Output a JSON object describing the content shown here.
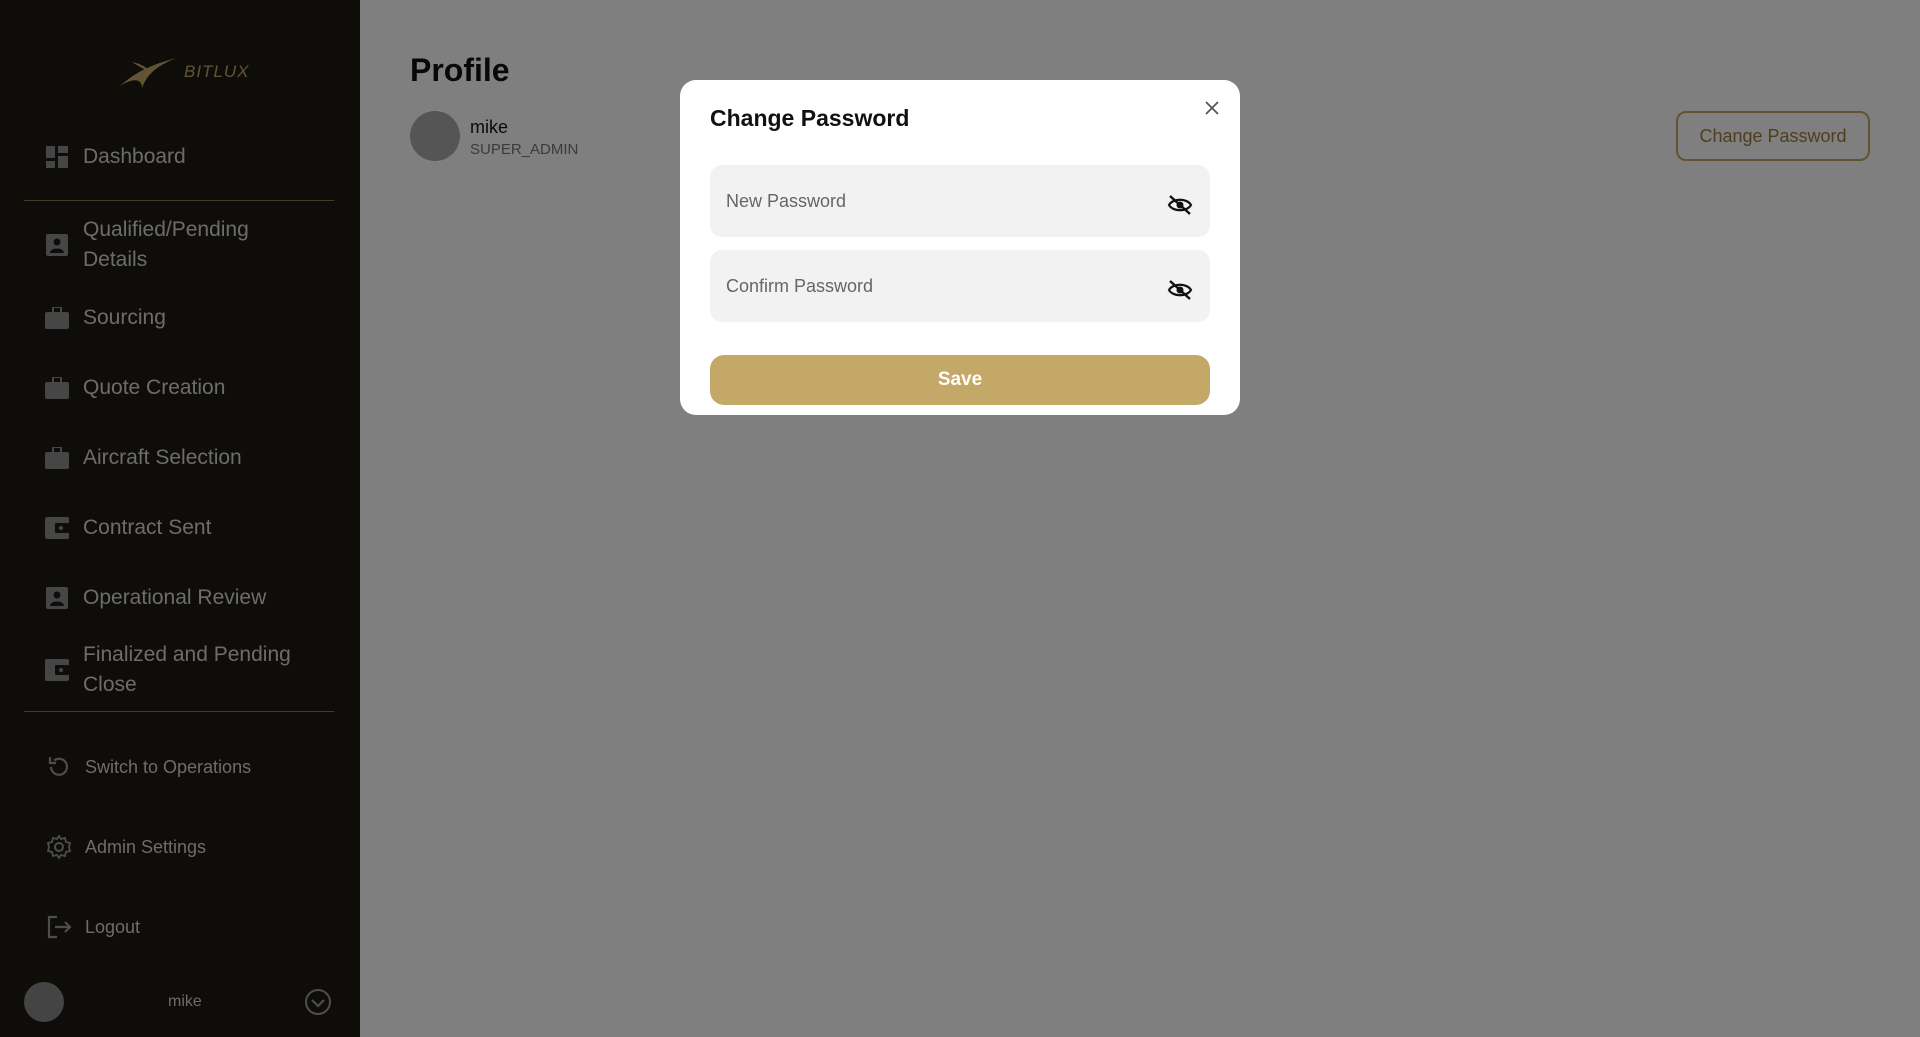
{
  "brand": {
    "name": "BITLUX",
    "accent": "#c4a867"
  },
  "sidebar": {
    "items": [
      {
        "label": "Dashboard",
        "icon": "dashboard-icon"
      },
      {
        "label": "Qualified/Pending\nDetails",
        "icon": "contact-card-icon"
      },
      {
        "label": "Sourcing",
        "icon": "briefcase-icon"
      },
      {
        "label": "Quote Creation",
        "icon": "briefcase-icon"
      },
      {
        "label": "Aircraft Selection",
        "icon": "briefcase-icon"
      },
      {
        "label": "Contract Sent",
        "icon": "wallet-icon"
      },
      {
        "label": "Operational Review",
        "icon": "contact-card-icon"
      },
      {
        "label": "Finalized and Pending\nClose",
        "icon": "wallet-icon"
      }
    ],
    "bottom": [
      {
        "label": "Switch to Operations",
        "icon": "refresh-icon"
      },
      {
        "label": "Admin Settings",
        "icon": "gear-icon"
      },
      {
        "label": "Logout",
        "icon": "logout-icon"
      }
    ],
    "user": {
      "name": "mike"
    }
  },
  "main": {
    "title": "Profile",
    "profile": {
      "name": "mike",
      "role": "SUPER_ADMIN"
    },
    "change_password_button": "Change Password"
  },
  "modal": {
    "title": "Change Password",
    "new_password_placeholder": "New Password",
    "confirm_password_placeholder": "Confirm Password",
    "save_label": "Save"
  }
}
